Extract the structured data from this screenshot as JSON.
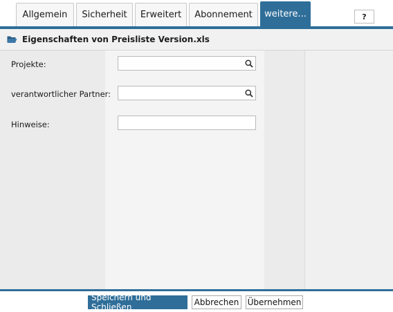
{
  "tabs": [
    {
      "label": "Allgemein",
      "active": false
    },
    {
      "label": "Sicherheit",
      "active": false
    },
    {
      "label": "Erweitert",
      "active": false
    },
    {
      "label": "Abonnement",
      "active": false
    },
    {
      "label": "weitere...",
      "active": true
    }
  ],
  "help": {
    "label": "?"
  },
  "header": {
    "icon": "open-folder-icon",
    "title": "Eigenschaften von Preisliste Version.xls"
  },
  "form": {
    "fields": [
      {
        "label": "Projekte:",
        "value": "",
        "lookup_icon": "search-icon"
      },
      {
        "label": "verantwortlicher Partner:",
        "value": "",
        "lookup_icon": "search-icon"
      },
      {
        "label": "Hinweise:",
        "value": ""
      }
    ]
  },
  "footer": {
    "save_close_label": "Speichern und Schließen",
    "cancel_label": "Abbrechen",
    "apply_label": "Übernehmen"
  },
  "colors": {
    "accent": "#2f6e99",
    "folder": "#2b5d86"
  }
}
